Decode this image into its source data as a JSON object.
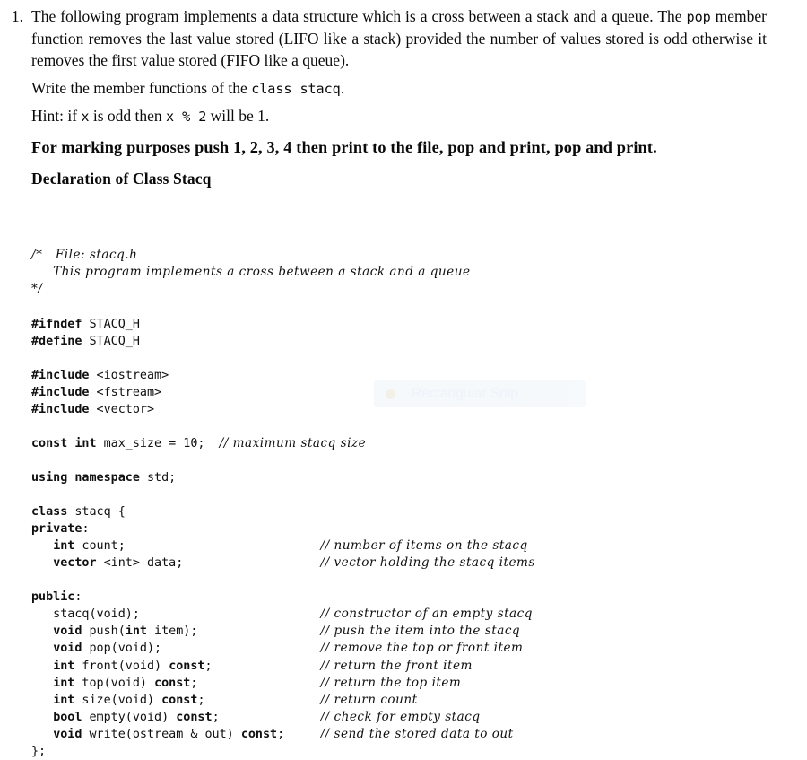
{
  "document": {
    "problem_number": "1.",
    "paragraph_1_parts": {
      "a": "The following program implements a data structure which is a cross between a stack and a queue. The ",
      "code_pop": "pop",
      "b": " member function removes the last value stored (LIFO like a stack) provided the number of values stored is odd otherwise it removes the first value stored (FIFO like a queue)."
    },
    "paragraph_2_parts": {
      "a": "Write the member functions of the ",
      "code_class_stacq": "class stacq",
      "b": "."
    },
    "paragraph_3_parts": {
      "a": "Hint: if ",
      "code_x": "x",
      "b": " is odd then ",
      "code_x_mod_2": "x % 2",
      "c": " will be 1."
    },
    "marking_note": "For marking purposes push 1, 2, 3, 4 then print to the file, pop and print, pop and print.",
    "section_heading": "Declaration of Class Stacq"
  },
  "listing": {
    "language": "cpp",
    "lines": [
      {
        "indent": 0,
        "code": "/*   File: stacq.h",
        "style": "comment"
      },
      {
        "indent": 0,
        "code": "     This program implements a cross between a stack and a queue",
        "style": "comment"
      },
      {
        "indent": 0,
        "code": "*/",
        "style": "comment"
      },
      {
        "indent": 0,
        "code": "",
        "style": "blank"
      },
      {
        "indent": 0,
        "code": "#ifndef STACQ_H",
        "style": "preproc"
      },
      {
        "indent": 0,
        "code": "#define STACQ_H",
        "style": "preproc"
      },
      {
        "indent": 0,
        "code": "",
        "style": "blank"
      },
      {
        "indent": 0,
        "code": "#include <iostream>",
        "style": "preproc"
      },
      {
        "indent": 0,
        "code": "#include <fstream>",
        "style": "preproc"
      },
      {
        "indent": 0,
        "code": "#include <vector>",
        "style": "preproc"
      },
      {
        "indent": 0,
        "code": "",
        "style": "blank"
      },
      {
        "indent": 0,
        "code": "const int max_size = 10;",
        "comment": "// maximum stacq size"
      },
      {
        "indent": 0,
        "code": "",
        "style": "blank"
      },
      {
        "indent": 0,
        "code": "using namespace std;",
        "style": "plain"
      },
      {
        "indent": 0,
        "code": "",
        "style": "blank"
      },
      {
        "indent": 0,
        "code": "class stacq {",
        "style": "plain"
      },
      {
        "indent": 0,
        "code": "private:",
        "style": "plain"
      },
      {
        "indent": 1,
        "code": "int count;",
        "comment": "// number of items on the stacq"
      },
      {
        "indent": 1,
        "code": "vector <int> data;",
        "comment": "// vector holding the stacq items"
      },
      {
        "indent": 0,
        "code": "",
        "style": "blank"
      },
      {
        "indent": 0,
        "code": "public:",
        "style": "plain"
      },
      {
        "indent": 1,
        "code": "stacq(void);",
        "comment": "// constructor of an empty stacq"
      },
      {
        "indent": 1,
        "code": "void push(int item);",
        "comment": "// push the item into the stacq"
      },
      {
        "indent": 1,
        "code": "void pop(void);",
        "comment": "// remove the top or front item"
      },
      {
        "indent": 1,
        "code": "int front(void) const;",
        "comment": "// return the front item"
      },
      {
        "indent": 1,
        "code": "int top(void) const;",
        "comment": "// return the top item"
      },
      {
        "indent": 1,
        "code": "int size(void) const;",
        "comment": "// return count"
      },
      {
        "indent": 1,
        "code": "bool empty(void) const;",
        "comment": "// check for empty stacq"
      },
      {
        "indent": 1,
        "code": "void write(ostream & out) const;",
        "comment": "// send the stored data to out"
      },
      {
        "indent": 0,
        "code": "};",
        "style": "plain"
      }
    ]
  },
  "overlay": {
    "label": "Rectangular Snip",
    "icon": "rectangular-snip-icon",
    "background_color": "#eef5fb",
    "text_color": "#dfeaf5"
  }
}
